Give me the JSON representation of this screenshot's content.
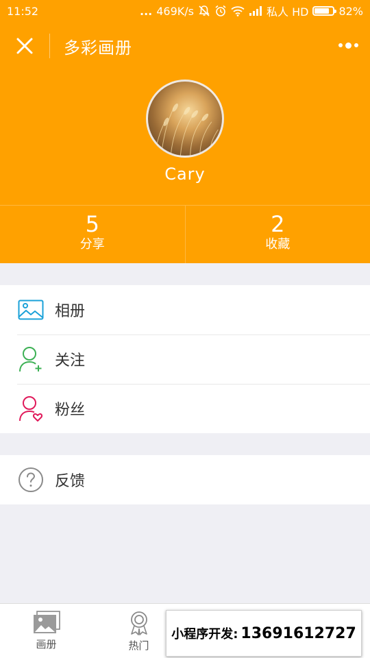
{
  "status_bar": {
    "time": "11:52",
    "dots": "...",
    "network_speed": "469K/s",
    "carrier": "私人 HD",
    "battery": "82%",
    "battery_level": 0.82,
    "icons": [
      "mute-bell-icon",
      "alarm-icon",
      "wifi-icon",
      "signal-icon",
      "battery-icon"
    ]
  },
  "navbar": {
    "title": "多彩画册",
    "close_icon": "close-icon",
    "more_icon": "more-dots-icon"
  },
  "profile": {
    "name": "Cary"
  },
  "stats": [
    {
      "value": "5",
      "label": "分享"
    },
    {
      "value": "2",
      "label": "收藏"
    }
  ],
  "menu": {
    "group1": [
      {
        "label": "相册",
        "icon": "photo-album-icon",
        "color": "#1aa1d8"
      },
      {
        "label": "关注",
        "icon": "add-user-icon",
        "color": "#3cb054"
      },
      {
        "label": "粉丝",
        "icon": "user-heart-icon",
        "color": "#e0195a"
      }
    ],
    "group2": [
      {
        "label": "反馈",
        "icon": "question-icon",
        "color": "#8a8a8a"
      }
    ]
  },
  "tabbar": [
    {
      "label": "画册",
      "icon": "gallery-icon"
    },
    {
      "label": "热门",
      "icon": "award-icon"
    }
  ],
  "promo": {
    "label": "小程序开发:",
    "phone": "13691612727"
  },
  "colors": {
    "brand": "#ffa100",
    "background": "#efeff4"
  }
}
